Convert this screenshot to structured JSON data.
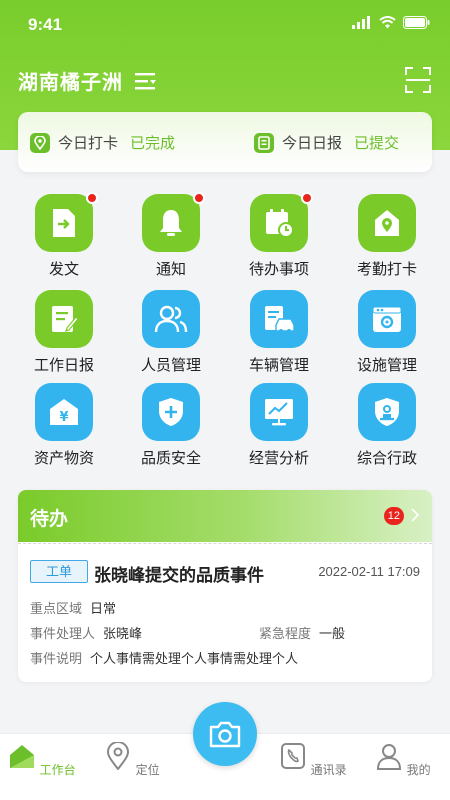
{
  "status_bar": {
    "time": "9:41"
  },
  "header": {
    "title": "湖南橘子洲"
  },
  "checkin": {
    "punch_label": "今日打卡",
    "punch_status": "已完成",
    "report_label": "今日日报",
    "report_status": "已提交"
  },
  "grid": [
    {
      "label": "发文",
      "icon": "document-send-icon",
      "color": "green",
      "badge": true
    },
    {
      "label": "通知",
      "icon": "bell-icon",
      "color": "green",
      "badge": true
    },
    {
      "label": "待办事项",
      "icon": "calendar-clock-icon",
      "color": "green",
      "badge": true
    },
    {
      "label": "考勤打卡",
      "icon": "location-home-icon",
      "color": "green",
      "badge": false
    },
    {
      "label": "工作日报",
      "icon": "edit-report-icon",
      "color": "green",
      "badge": false
    },
    {
      "label": "人员管理",
      "icon": "people-icon",
      "color": "blue",
      "badge": false
    },
    {
      "label": "车辆管理",
      "icon": "vehicle-icon",
      "color": "blue",
      "badge": false
    },
    {
      "label": "设施管理",
      "icon": "facility-gear-icon",
      "color": "blue",
      "badge": false
    },
    {
      "label": "资产物资",
      "icon": "asset-yen-icon",
      "color": "blue",
      "badge": false
    },
    {
      "label": "品质安全",
      "icon": "shield-plus-icon",
      "color": "blue",
      "badge": false
    },
    {
      "label": "经营分析",
      "icon": "chart-board-icon",
      "color": "blue",
      "badge": false
    },
    {
      "label": "综合行政",
      "icon": "admin-badge-icon",
      "color": "blue",
      "badge": false
    }
  ],
  "todo": {
    "title": "待办",
    "count": "12",
    "tag": "工单",
    "event_title": "张晓峰提交的品质事件",
    "event_time": "2022-02-11 17:09",
    "area_label": "重点区域",
    "area_value": "日常",
    "handler_label": "事件处理人",
    "handler_value": "张晓峰",
    "urgency_label": "紧急程度",
    "urgency_value": "一般",
    "desc_label": "事件说明",
    "desc_value": "个人事情需处理个人事情需处理个人"
  },
  "tabbar": {
    "workbench": "工作台",
    "location": "定位",
    "contacts": "通讯录",
    "mine": "我的"
  },
  "colors": {
    "brand_green": "#7acb2a",
    "brand_blue": "#34b4ee",
    "badge_red": "#e8241c"
  }
}
